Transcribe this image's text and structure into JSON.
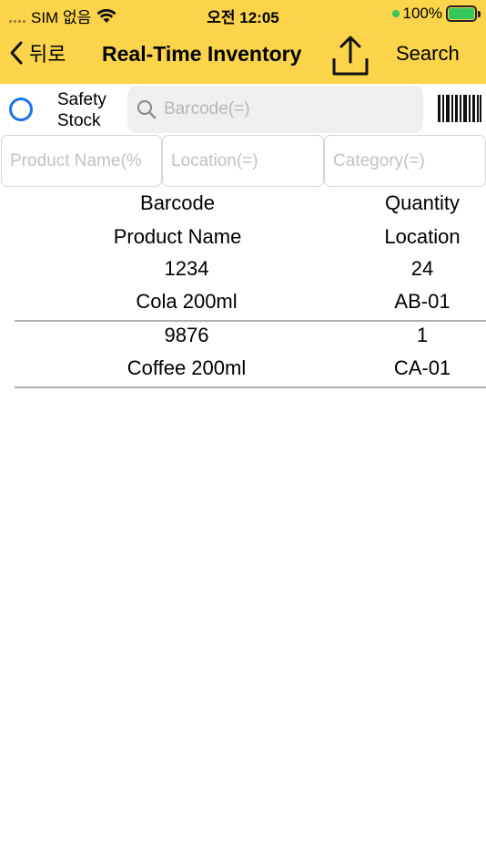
{
  "status": {
    "carrier": "SIM 없음",
    "time": "오전 12:05",
    "battery": "100%"
  },
  "nav": {
    "back_label": "뒤로",
    "title": "Real-Time Inventory",
    "search_label": "Search"
  },
  "filters": {
    "safety_stock_label_line1": "Safety",
    "safety_stock_label_line2": "Stock",
    "barcode_placeholder": "Barcode(=)",
    "product_name_placeholder": "Product Name(%",
    "location_placeholder": "Location(=)",
    "category_placeholder": "Category(=)"
  },
  "table": {
    "headers": {
      "barcode": "Barcode",
      "quantity": "Quantity",
      "product_name": "Product Name",
      "location": "Location"
    },
    "rows": [
      {
        "barcode": "1234",
        "quantity": "24",
        "product_name": "Cola 200ml",
        "location": "AB-01"
      },
      {
        "barcode": "9876",
        "quantity": "1",
        "product_name": "Coffee 200ml",
        "location": "CA-01"
      }
    ]
  },
  "colors": {
    "header_bg": "#fbd44b",
    "radio_accent": "#1a73e8",
    "battery_green": "#34c759"
  }
}
